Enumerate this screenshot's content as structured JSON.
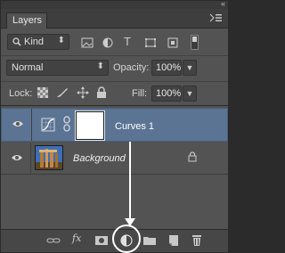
{
  "panel": {
    "tab_label": "Layers",
    "collapse_glyph": "«",
    "menu_icon": "panel-menu-icon"
  },
  "filter": {
    "kind_label": "Kind",
    "icons": [
      "pixel-filter-icon",
      "adjustment-filter-icon",
      "type-filter-icon",
      "shape-filter-icon",
      "smart-object-filter-icon"
    ]
  },
  "blend": {
    "mode": "Normal",
    "opacity_label": "Opacity:",
    "opacity_value": "100%"
  },
  "lock": {
    "label": "Lock:",
    "icons": [
      "lock-transparent-icon",
      "lock-image-icon",
      "lock-position-icon",
      "lock-all-icon"
    ],
    "fill_label": "Fill:",
    "fill_value": "100%"
  },
  "layers": [
    {
      "name": "Curves 1",
      "type": "adjustment",
      "selected": true
    },
    {
      "name": "Background",
      "type": "pixel",
      "locked": true
    }
  ],
  "footer": {
    "fx_label": "fx",
    "buttons": [
      "link-layers-icon",
      "add-layer-style-icon",
      "add-mask-icon",
      "new-adjustment-layer-icon",
      "new-group-icon",
      "new-layer-icon",
      "delete-layer-icon"
    ]
  },
  "colors": {
    "panel_bg": "#535353",
    "selected_row": "#5c7493",
    "annotation": "#ffffff"
  }
}
